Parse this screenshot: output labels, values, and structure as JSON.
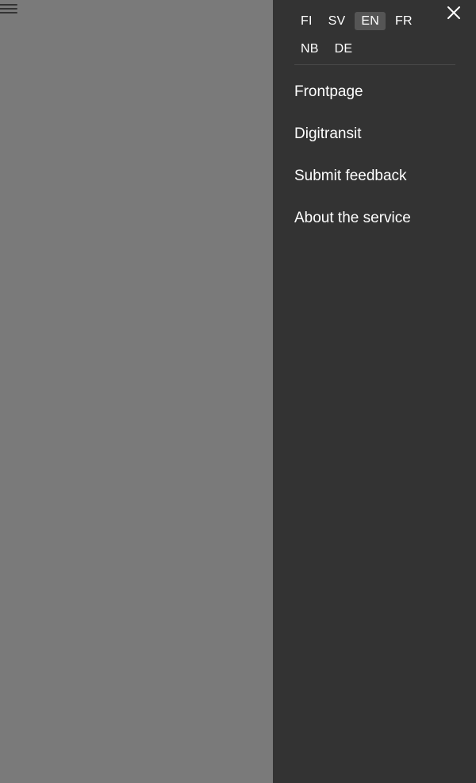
{
  "header": {
    "menu_icon": "hamburger-icon"
  },
  "drawer": {
    "close_icon": "close-icon",
    "languages": [
      {
        "code": "FI",
        "active": false
      },
      {
        "code": "SV",
        "active": false
      },
      {
        "code": "EN",
        "active": true
      },
      {
        "code": "FR",
        "active": false
      },
      {
        "code": "NB",
        "active": false
      },
      {
        "code": "DE",
        "active": false
      }
    ],
    "menu_items": [
      {
        "label": "Frontpage"
      },
      {
        "label": "Digitransit"
      },
      {
        "label": "Submit feedback"
      },
      {
        "label": "About the service"
      }
    ],
    "colors": {
      "drawer_bg": "#333333",
      "overlay": "#7a7a7a",
      "active_lang_bg": "#555555",
      "text": "#ffffff"
    }
  }
}
